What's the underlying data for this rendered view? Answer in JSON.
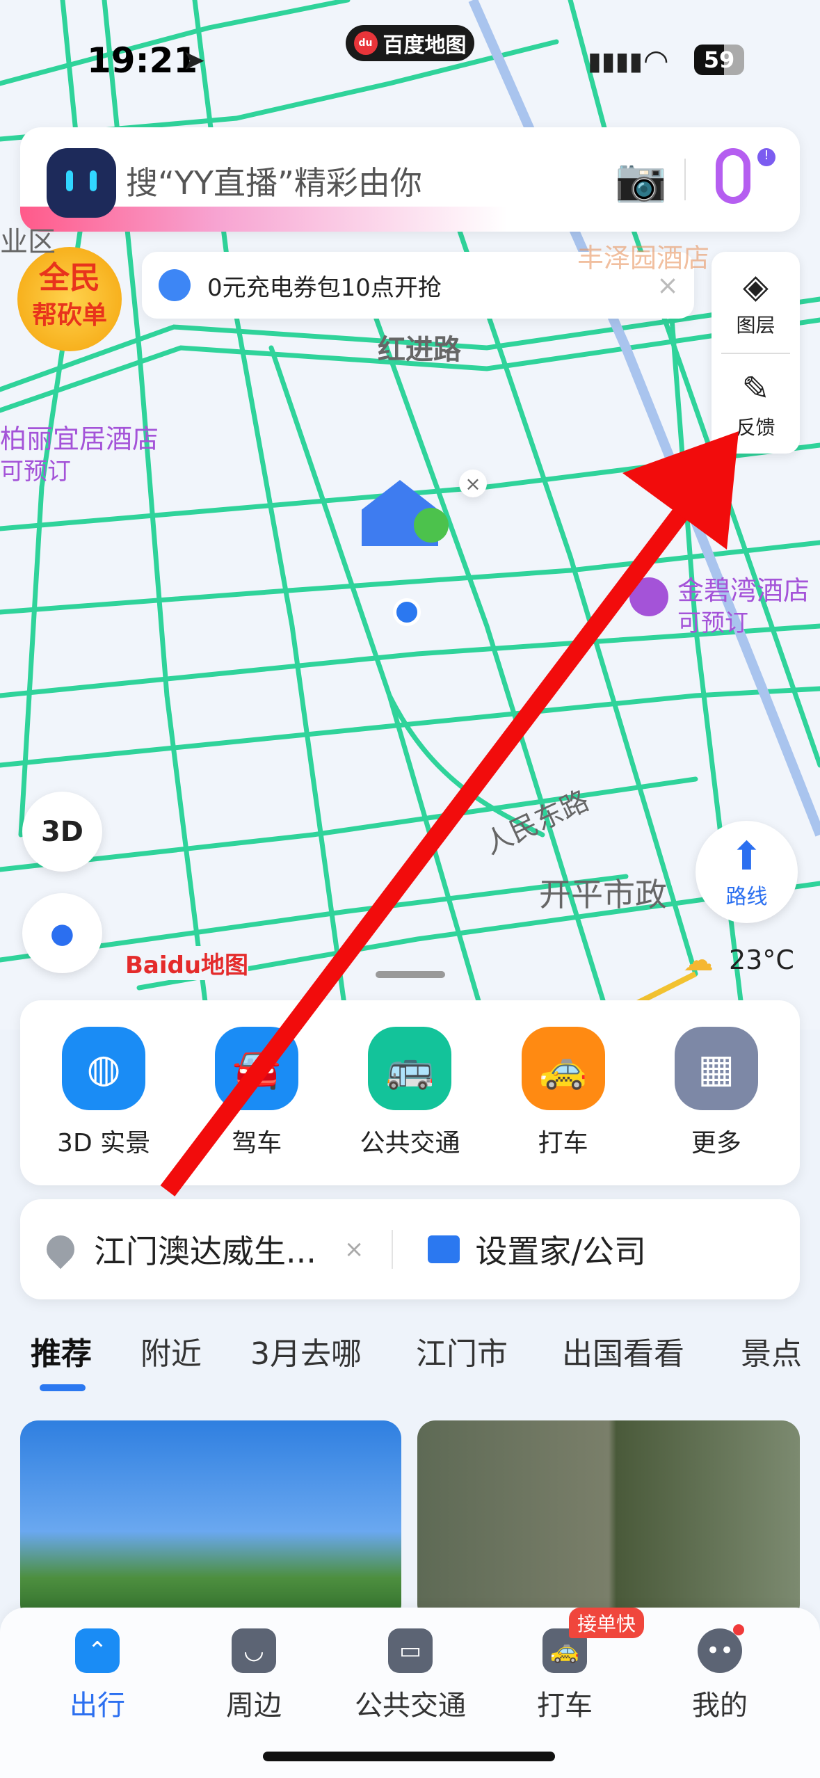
{
  "status_bar": {
    "time": "19:21",
    "battery": "59",
    "app_pill": "百度地图",
    "app_pill_logo": "du"
  },
  "search": {
    "placeholder": "搜“YY直播”精彩由你"
  },
  "promo": {
    "text": "0元充电券包10点开抢"
  },
  "side_panel": {
    "layers": "图层",
    "feedback": "反馈"
  },
  "badge": {
    "line1": "全民",
    "line2": "帮砍单"
  },
  "map": {
    "labels": {
      "road1": "红进路",
      "road2": "人民东路",
      "district": "业区",
      "place": "开平市政",
      "hotel1": "柏丽宜居酒店",
      "hotel1_sub": "可预订",
      "hotel2": "金碧湾酒店",
      "hotel2_sub": "可预订",
      "hotel3": "丰泽园酒店"
    },
    "mode_3d": "3D",
    "route": "路线",
    "weather": "23°C",
    "logo": "Baidu地图"
  },
  "quick_actions": [
    {
      "label": "3D 实景",
      "color": "#1a8cf5"
    },
    {
      "label": "驾车",
      "color": "#1a8cf5"
    },
    {
      "label": "公共交通",
      "color": "#13c39a"
    },
    {
      "label": "打车",
      "color": "#ff8a12"
    },
    {
      "label": "更多",
      "color": "#7d88a6"
    }
  ],
  "location": {
    "current": "江门澳达威生...",
    "set_home": "设置家/公司"
  },
  "tabs": [
    "推荐",
    "附近",
    "3月去哪",
    "江门市",
    "出国看看",
    "景点"
  ],
  "active_tab": 0,
  "bottom_nav": [
    {
      "label": "出行",
      "active": true
    },
    {
      "label": "周边"
    },
    {
      "label": "公共交通"
    },
    {
      "label": "打车",
      "badge": "接单快"
    },
    {
      "label": "我的",
      "dot": true
    }
  ],
  "colors": {
    "accent": "#2b6ff0",
    "road": "#2fd39a",
    "arrow": "#f20c0c"
  }
}
